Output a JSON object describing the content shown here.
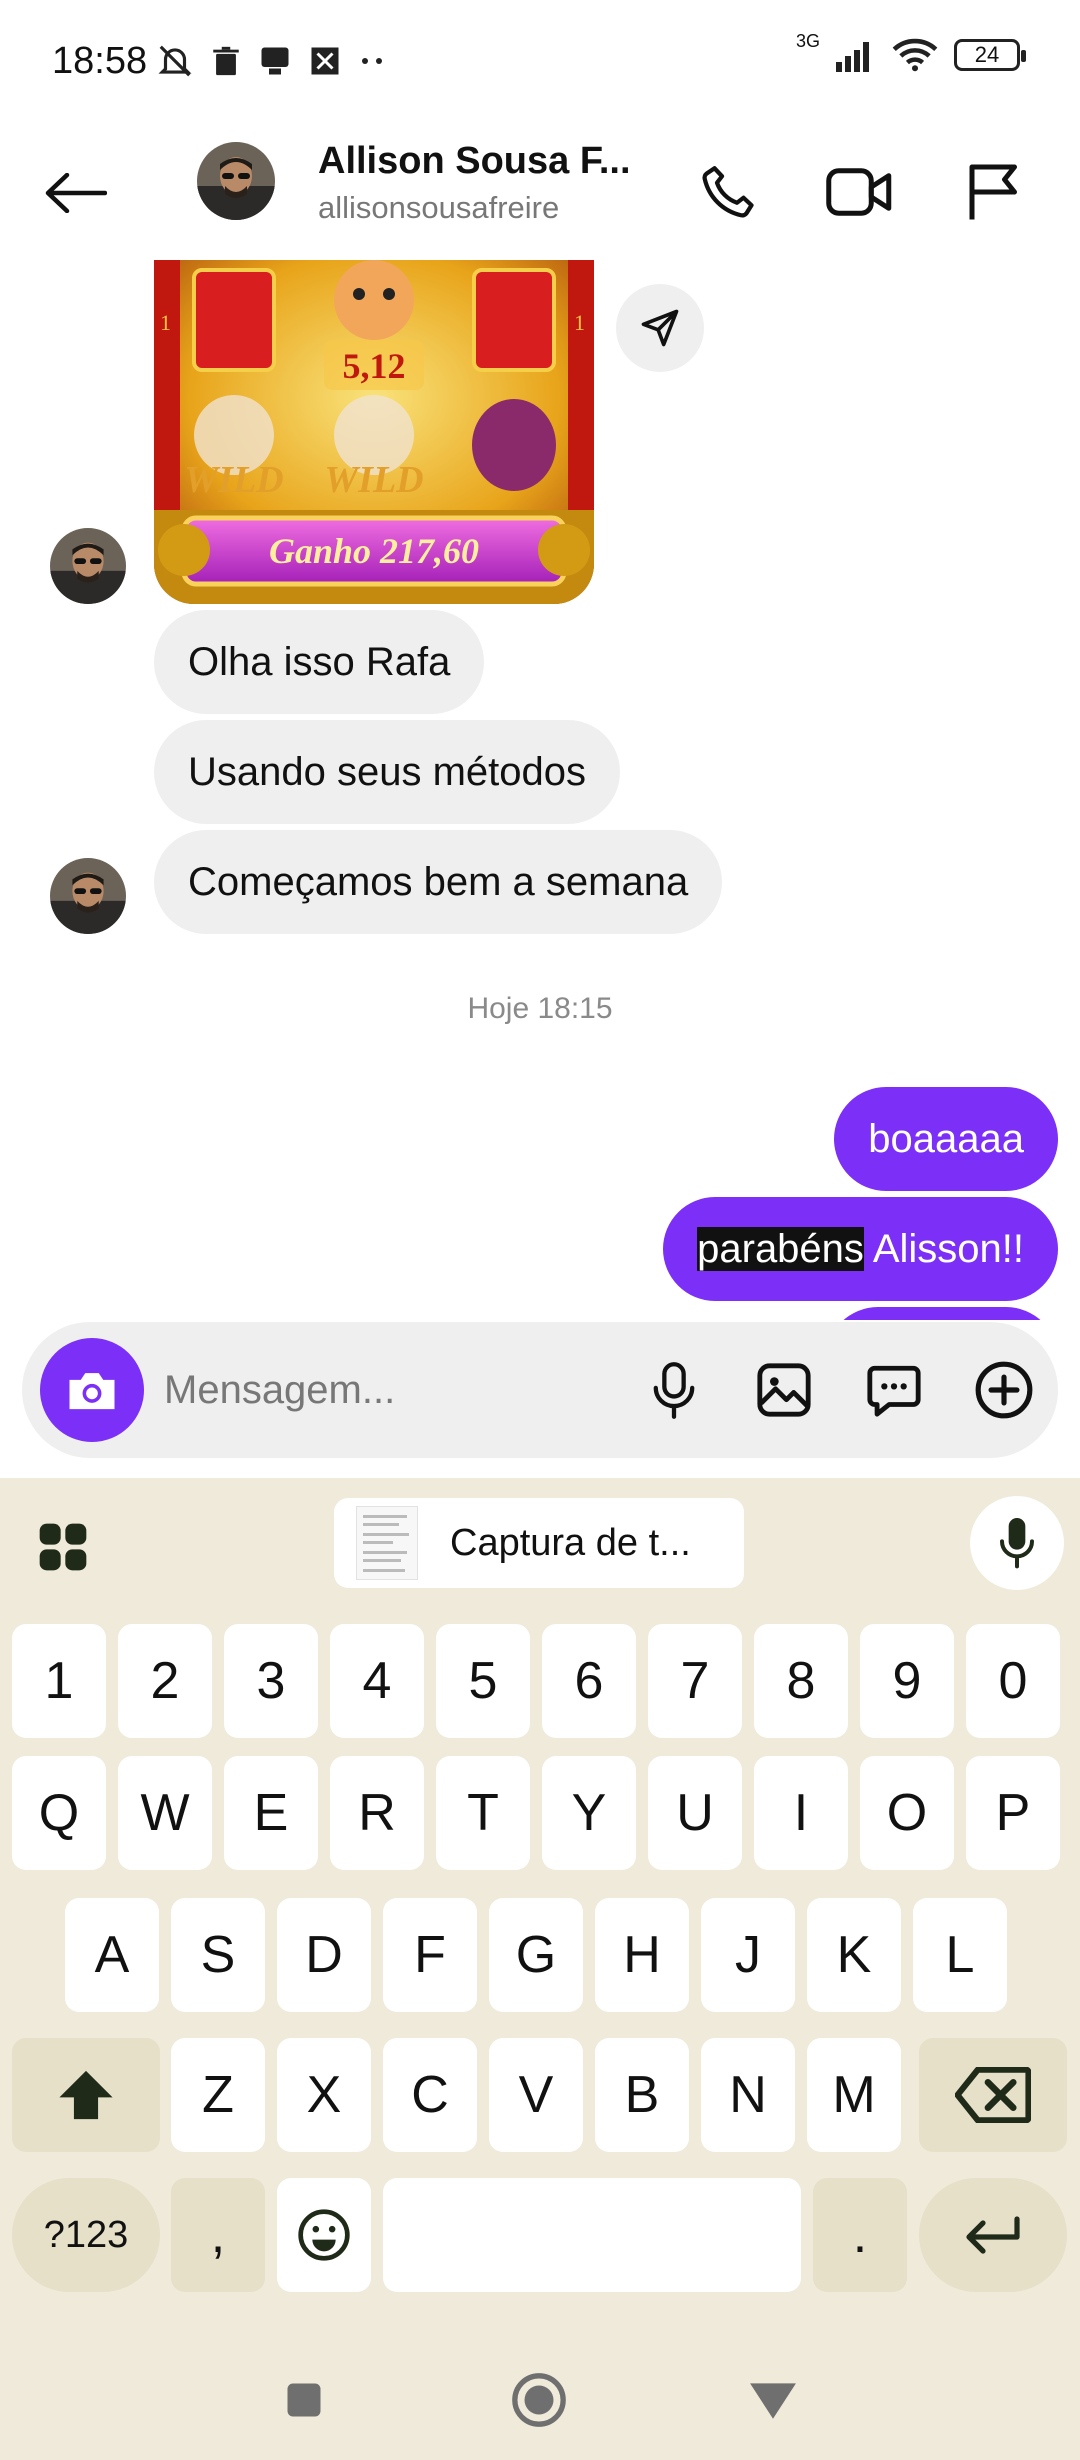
{
  "status_bar": {
    "time": "18:58",
    "network": "3G",
    "battery": "24",
    "left_icons": [
      "muted-bell-icon",
      "trash-icon",
      "cast-icon",
      "crossed-box-icon",
      "more-dots-icon"
    ],
    "right_icons": [
      "signal-icon",
      "wifi-icon",
      "battery-icon"
    ]
  },
  "header": {
    "contact_name": "Allison Sousa F...",
    "contact_username": "allisonsousafreire",
    "icons": [
      "back-arrow-icon",
      "phone-icon",
      "video-icon",
      "flag-icon"
    ]
  },
  "image_message": {
    "slot_multiplier": "5,12",
    "win_label": "Ganho 217,60",
    "wild_labels": [
      "WILD",
      "WILD"
    ],
    "reel_marker": "1"
  },
  "messages_in": [
    {
      "text": "Olha isso Rafa"
    },
    {
      "text": "Usando seus métodos"
    },
    {
      "text": "Começamos bem a semana"
    }
  ],
  "timestamp": "Hoje 18:15",
  "messages_out": [
    {
      "text": "boaaaaa"
    },
    {
      "selected": "parabéns",
      "rest": " Alisson!!"
    }
  ],
  "composer": {
    "placeholder": "Mensagem...",
    "icons": [
      "camera-icon",
      "microphone-icon",
      "gallery-icon",
      "sticker-chat-icon",
      "add-icon"
    ]
  },
  "keyboard": {
    "clipboard_label": "Captura de t...",
    "number_row": [
      "1",
      "2",
      "3",
      "4",
      "5",
      "6",
      "7",
      "8",
      "9",
      "0"
    ],
    "row1": [
      "Q",
      "W",
      "E",
      "R",
      "T",
      "Y",
      "U",
      "I",
      "O",
      "P"
    ],
    "row2": [
      "A",
      "S",
      "D",
      "F",
      "G",
      "H",
      "J",
      "K",
      "L"
    ],
    "row3": [
      "Z",
      "X",
      "C",
      "V",
      "B",
      "N",
      "M"
    ],
    "symbols_label": "?123",
    "comma": ",",
    "period": ".",
    "accent_color": "#efeada"
  },
  "theme": {
    "accent": "#7b2ff7",
    "incoming_bubble": "#efefef"
  }
}
